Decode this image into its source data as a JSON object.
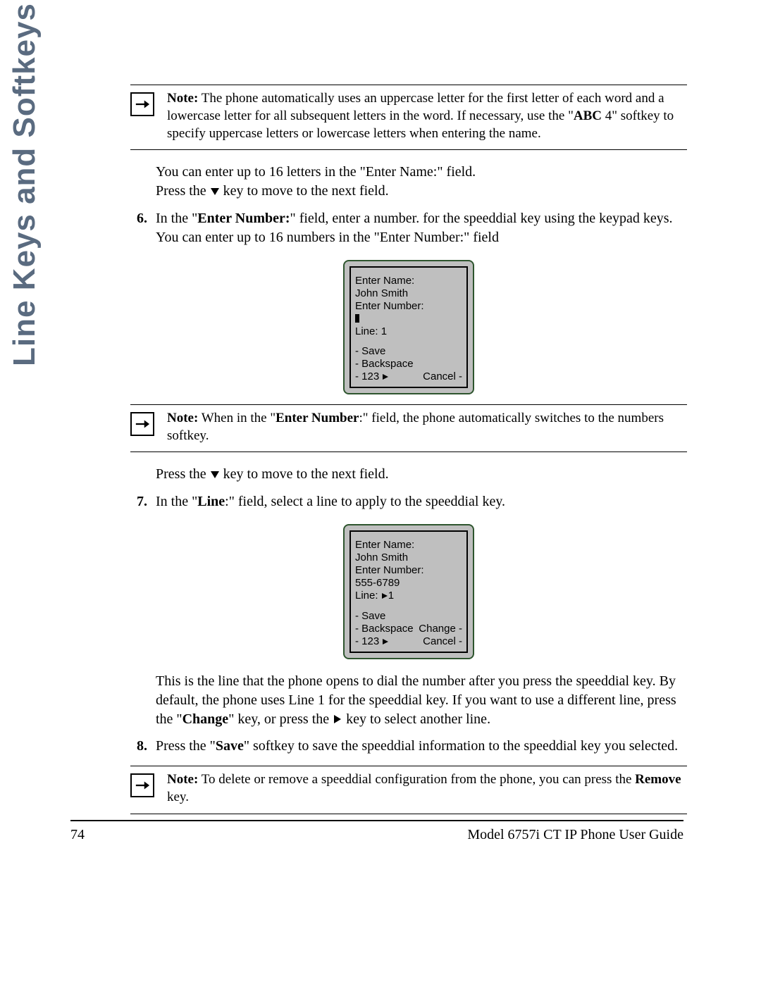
{
  "side_title": "Line Keys and Softkeys",
  "note1": {
    "lead": "Note:",
    "rest": " The phone automatically uses an uppercase letter for the first letter of each word and a lowercase letter for all subsequent letters in the word. If necessary, use the \"",
    "bold": "ABC",
    "after_bold": " 4\" softkey to specify uppercase letters or lowercase letters when entering the name."
  },
  "para1_a": "You can enter up to 16 letters in the \"Enter Name:\" field.",
  "para1_b_pre": "Press the ",
  "para1_b_post": " key to move to the next field.",
  "step6": {
    "num": "6.",
    "pre": "In the \"",
    "bold": "Enter Number:",
    "mid": "\" field, enter a number. for the speeddial key using the keypad keys. You can enter up to 16 numbers in the \"Enter Number:\" field"
  },
  "phone1": {
    "l1": "Enter Name:",
    "l2": "John Smith",
    "l3": "Enter Number:",
    "l4_cursor": true,
    "l5": "Line: 1",
    "sk1": "- Save",
    "sk2": "- Backspace",
    "sk3_left": "- 123",
    "sk3_right": "Cancel -"
  },
  "note2": {
    "lead": "Note:",
    "pre": " When in the \"",
    "bold": "Enter Number",
    "post": ":\" field, the phone automatically switches to the numbers softkey."
  },
  "para2_pre": "Press the ",
  "para2_post": " key to move to the next field.",
  "step7": {
    "num": "7.",
    "pre": "In the \"",
    "bold": "Line",
    "post": ":\" field, select a line to apply to the speeddial key."
  },
  "phone2": {
    "l1": "Enter Name:",
    "l2": "John Smith",
    "l3": "Enter Number:",
    "l4": "555-6789",
    "l5_pre": "Line: ",
    "l5_val": "1",
    "sk1": "- Save",
    "sk2_left": "- Backspace",
    "sk2_right": "Change -",
    "sk3_left": "- 123",
    "sk3_right": "Cancel -"
  },
  "para3_a": "This is the line that the phone opens to dial the number after you press the speeddial key. By default, the phone uses Line 1 for the speeddial key. If you want to use a different line, press the \"",
  "para3_bold": "Change",
  "para3_b": "\" key, or press the ",
  "para3_c": " key to select another line.",
  "step8": {
    "num": "8.",
    "pre": "Press the \"",
    "bold": "Save",
    "post": "\" softkey to save the speeddial information to the speeddial key you selected."
  },
  "note3": {
    "lead": "Note:",
    "pre": " To delete or remove a speeddial configuration from the phone, you can press the ",
    "bold": "Remove",
    "post": " key."
  },
  "footer": {
    "page": "74",
    "title": "Model 6757i CT IP Phone User Guide"
  }
}
